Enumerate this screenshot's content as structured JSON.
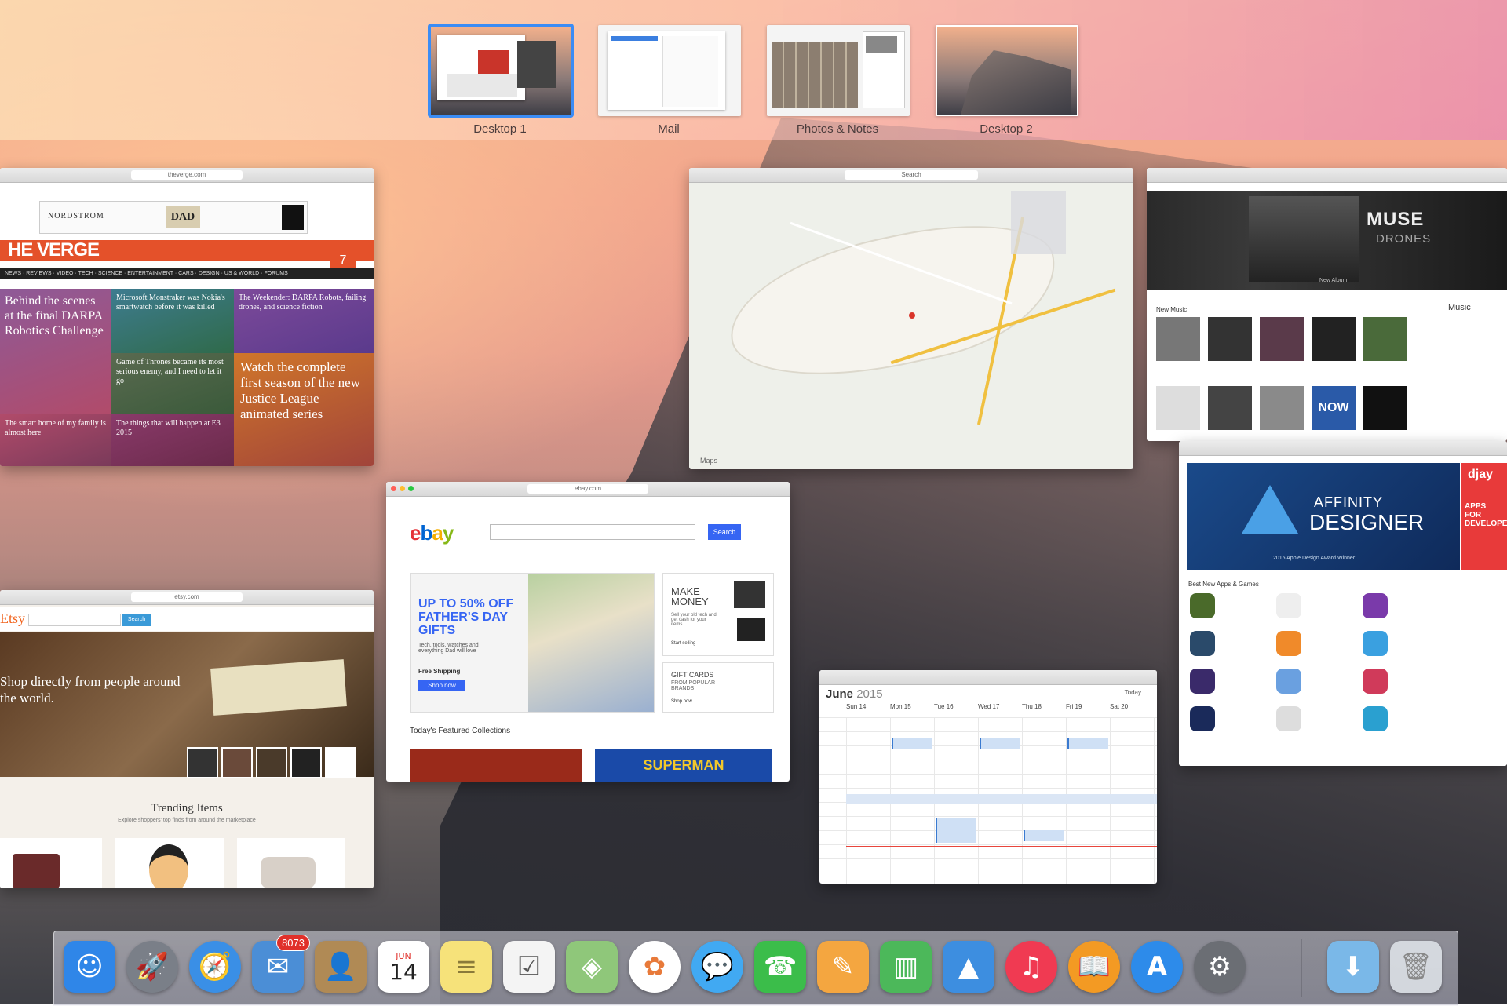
{
  "spaces": [
    {
      "label": "Desktop 1",
      "active": true
    },
    {
      "label": "Mail",
      "active": false
    },
    {
      "label": "Photos & Notes",
      "active": false
    },
    {
      "label": "Desktop 2",
      "active": false
    }
  ],
  "verge": {
    "logo": "HE VERGE",
    "ad_brand": "NORDSTROM",
    "ad_dad": "DAD",
    "tile_main": "Behind the scenes at the final DARPA Robotics Challenge",
    "tile_2": "Microsoft Monstraker was Nokia's smartwatch before it was killed",
    "tile_3": "The Weekender: DARPA Robots, failing drones, and science fiction",
    "tile_4": "Watch the complete first season of the new Justice League animated series",
    "tile_5": "Game of Thrones became its most serious enemy, and I need to let it go",
    "tile_6": "The smart home of my family is almost here",
    "tile_7": "The things that will happen at E3 2015"
  },
  "etsy": {
    "logo": "Etsy",
    "search_button": "Search",
    "hero_text": "Shop directly from people around the world.",
    "trending_title": "Trending Items",
    "trending_sub": "Explore shoppers' top finds from around the marketplace"
  },
  "ebay": {
    "logo": "ebay",
    "search_button": "Search",
    "promo_title": "UP TO 50% OFF FATHER'S DAY GIFTS",
    "promo_sub": "Tech, tools, watches and everything Dad will love",
    "promo_shipping": "Free Shipping",
    "promo_button": "Shop now",
    "side_title": "MAKE MONEY",
    "side_sub": "Sell your old tech and get cash for your items",
    "side_link": "Start selling",
    "gift_title": "GIFT CARDS",
    "gift_sub": "FROM POPULAR BRANDS",
    "gift_link": "Shop now",
    "collections": "Today's Featured Collections",
    "superman": "SUPERMAN"
  },
  "maps": {
    "attribution": "Maps"
  },
  "itunes": {
    "band": "MUSE",
    "album": "DRONES",
    "caption": "New Album",
    "section": "New Music",
    "sidebar_title": "Music",
    "now": "NOW"
  },
  "appstore": {
    "hero_title": "AFFINITY",
    "hero_title2": "DESIGNER",
    "hero_sub": "2015 Apple Design Award Winner",
    "side_brand": "djay",
    "side_text": "APPS FOR DEVELOPERS",
    "section": "Best New Apps & Games"
  },
  "calendar": {
    "month": "June",
    "year": "2015",
    "days": [
      "Sun 14",
      "Mon 15",
      "Tue 16",
      "Wed 17",
      "Thu 18",
      "Fri 19",
      "Sat 20"
    ],
    "today_label": "Today"
  },
  "dock": {
    "apps": [
      {
        "name": "Finder",
        "glyph": "☺",
        "color": "#2f86e8"
      },
      {
        "name": "Launchpad",
        "glyph": "🚀",
        "color": "#7a7f88"
      },
      {
        "name": "Safari",
        "glyph": "🧭",
        "color": "#3a8fe6"
      },
      {
        "name": "Mail",
        "glyph": "✉",
        "color": "#4b8ed6",
        "badge": "8073"
      },
      {
        "name": "Contacts",
        "glyph": "👤",
        "color": "#b08a55"
      },
      {
        "name": "Calendar",
        "glyph": "14",
        "color": "#ffffff",
        "month": "JUN"
      },
      {
        "name": "Notes",
        "glyph": "≡",
        "color": "#f6e27a"
      },
      {
        "name": "Reminders",
        "glyph": "☑",
        "color": "#f4f4f4"
      },
      {
        "name": "Maps",
        "glyph": "◈",
        "color": "#8fc77a"
      },
      {
        "name": "Photos",
        "glyph": "✿",
        "color": "#ffffff"
      },
      {
        "name": "Messages",
        "glyph": "💬",
        "color": "#41a9f2"
      },
      {
        "name": "FaceTime",
        "glyph": "☎",
        "color": "#3bbd4a"
      },
      {
        "name": "Pages",
        "glyph": "✎",
        "color": "#f4a640"
      },
      {
        "name": "Numbers",
        "glyph": "▥",
        "color": "#4cb85a"
      },
      {
        "name": "Keynote",
        "glyph": "▲",
        "color": "#3d8ee0"
      },
      {
        "name": "iTunes",
        "glyph": "♫",
        "color": "#f03a52"
      },
      {
        "name": "iBooks",
        "glyph": "📖",
        "color": "#f39a23"
      },
      {
        "name": "App Store",
        "glyph": "A",
        "color": "#2d8bea"
      },
      {
        "name": "System Preferences",
        "glyph": "⚙",
        "color": "#6b6e74"
      }
    ],
    "downloads_glyph": "⬇",
    "trash_glyph": "🗑"
  }
}
